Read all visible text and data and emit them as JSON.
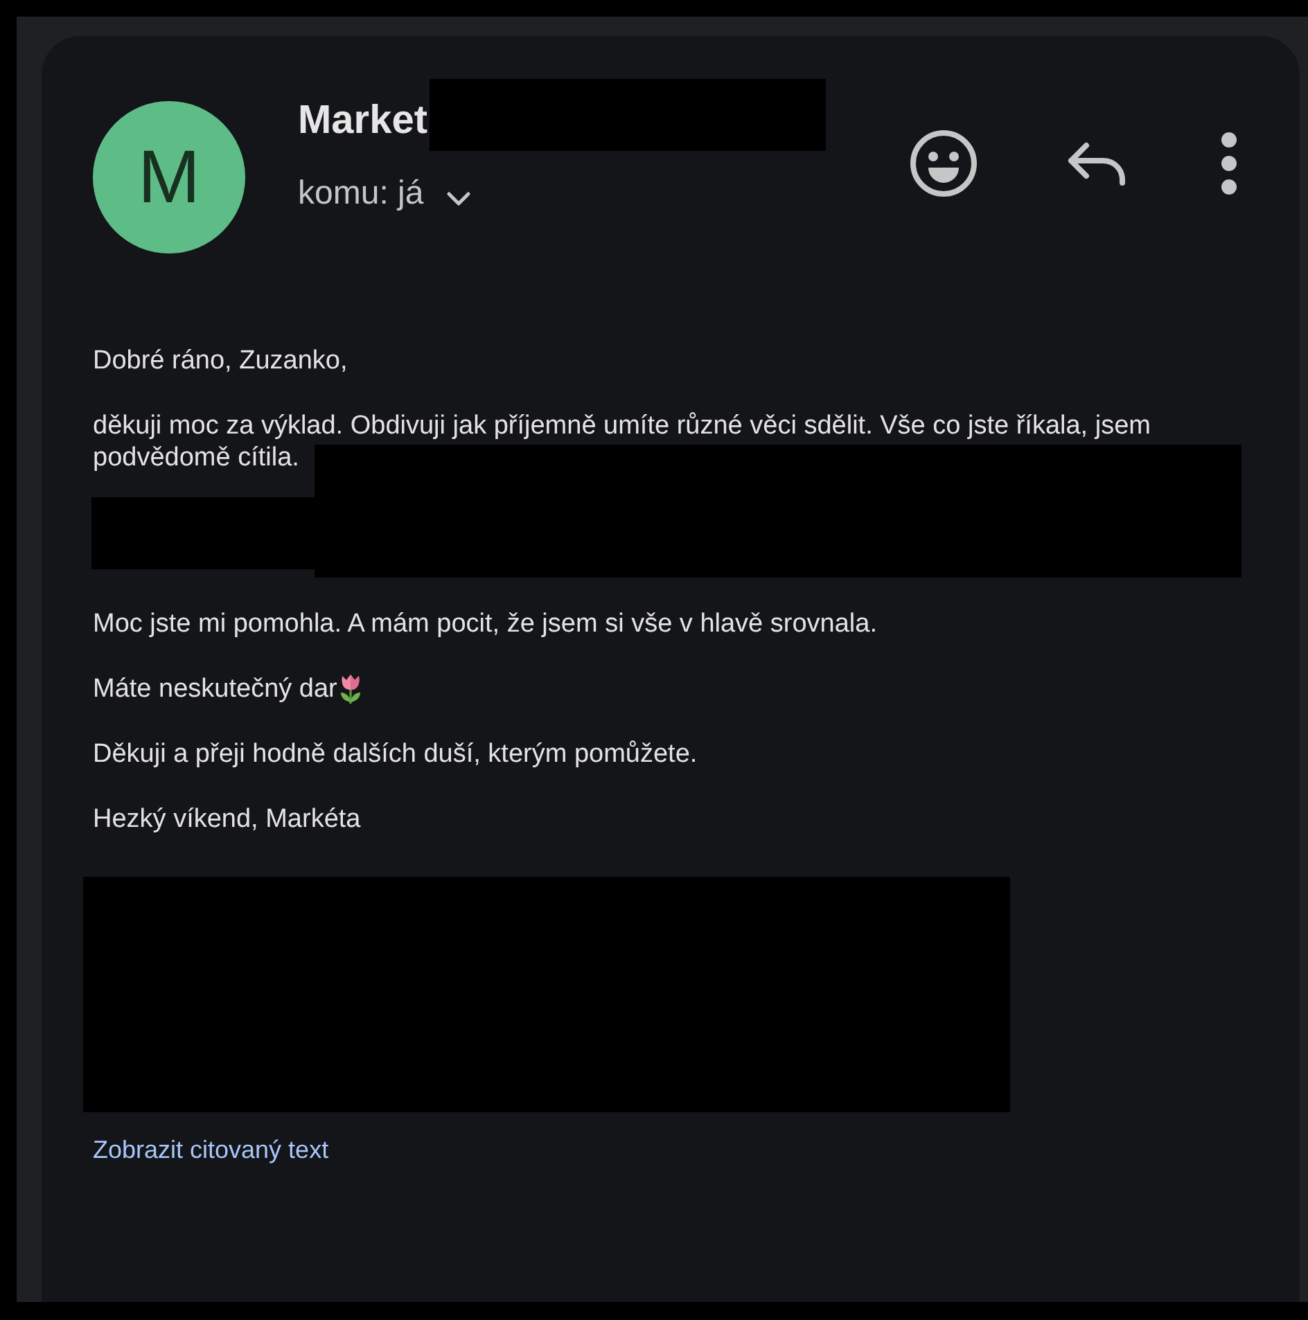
{
  "sender": {
    "avatar_letter": "M",
    "name": "Market",
    "recipient": "komu: já"
  },
  "message": {
    "paragraphs": [
      {
        "kind": "plain",
        "text": "Dobré ráno, Zuzanko,"
      },
      {
        "kind": "redacted",
        "text": "děkuji moc za výklad. Obdivuji jak příjemně umíte různé věci sdělit. Vše co jste říkala, jsem podvědomě cítila."
      },
      {
        "kind": "plain",
        "text": "Moc jste mi pomohla. A mám pocit, že jsem si vše v hlavě srovnala."
      },
      {
        "kind": "emoji",
        "text": "Máte neskutečný dar"
      },
      {
        "kind": "plain",
        "text": "Děkuji a přeji hodně dalších duší, kterým pomůžete."
      },
      {
        "kind": "plain",
        "text": "Hezký víkend, Markéta"
      }
    ]
  },
  "quoted_link": "Zobrazit citovaný text"
}
